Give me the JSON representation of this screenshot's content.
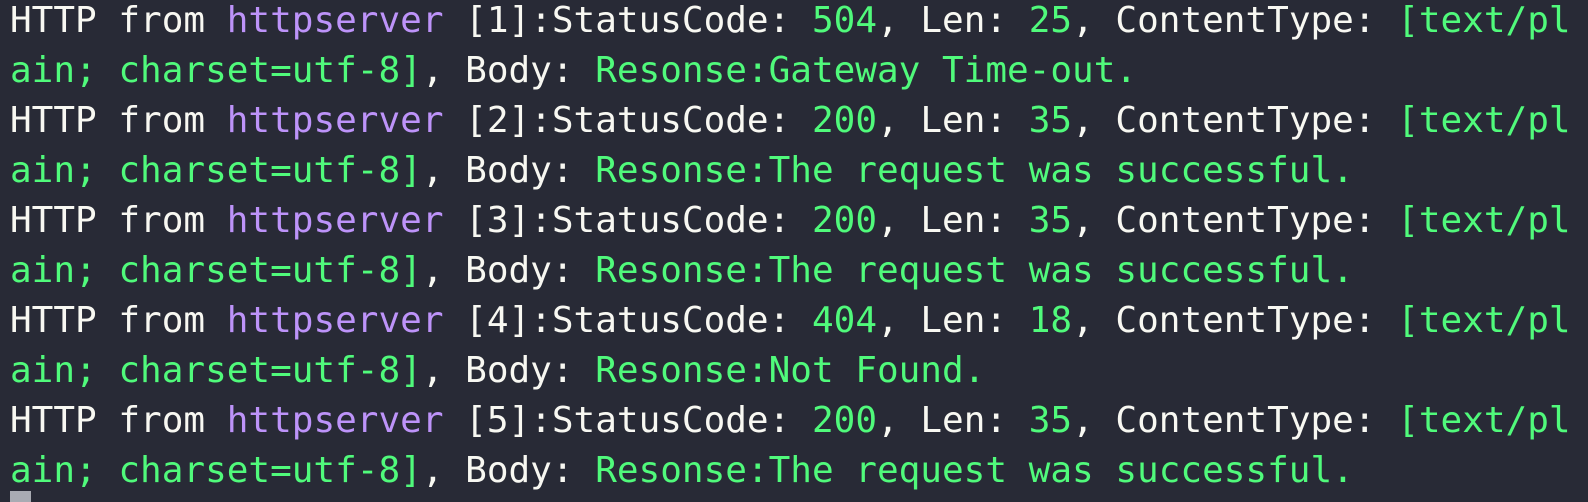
{
  "terminal": {
    "entries": [
      {
        "prefix": "HTTP from ",
        "host": "httpserver",
        "index_label": " [1]:StatusCode: ",
        "status": "504",
        "len_label": ", Len: ",
        "len": "25",
        "ct_label": ", ContentType: ",
        "ct_start": "[text/pl",
        "ct_end": "ain; charset=utf-8]",
        "body_label": ", Body: ",
        "body": "Resonse:Gateway Time-out."
      },
      {
        "prefix": "HTTP from ",
        "host": "httpserver",
        "index_label": " [2]:StatusCode: ",
        "status": "200",
        "len_label": ", Len: ",
        "len": "35",
        "ct_label": ", ContentType: ",
        "ct_start": "[text/pl",
        "ct_end": "ain; charset=utf-8]",
        "body_label": ", Body: ",
        "body": "Resonse:The request was successful."
      },
      {
        "prefix": "HTTP from ",
        "host": "httpserver",
        "index_label": " [3]:StatusCode: ",
        "status": "200",
        "len_label": ", Len: ",
        "len": "35",
        "ct_label": ", ContentType: ",
        "ct_start": "[text/pl",
        "ct_end": "ain; charset=utf-8]",
        "body_label": ", Body: ",
        "body": "Resonse:The request was successful."
      },
      {
        "prefix": "HTTP from ",
        "host": "httpserver",
        "index_label": " [4]:StatusCode: ",
        "status": "404",
        "len_label": ", Len: ",
        "len": "18",
        "ct_label": ", ContentType: ",
        "ct_start": "[text/pl",
        "ct_end": "ain; charset=utf-8]",
        "body_label": ", Body: ",
        "body": "Resonse:Not Found."
      },
      {
        "prefix": "HTTP from ",
        "host": "httpserver",
        "index_label": " [5]:StatusCode: ",
        "status": "200",
        "len_label": ", Len: ",
        "len": "35",
        "ct_label": ", ContentType: ",
        "ct_start": "[text/pl",
        "ct_end": "ain; charset=utf-8]",
        "body_label": ", Body: ",
        "body": "Resonse:The request was successful."
      }
    ],
    "colors": {
      "background": "#282a36",
      "foreground": "#f8f8f2",
      "host": "#bd93f9",
      "value": "#50fa7b",
      "cursor": "#a9abb3"
    }
  }
}
